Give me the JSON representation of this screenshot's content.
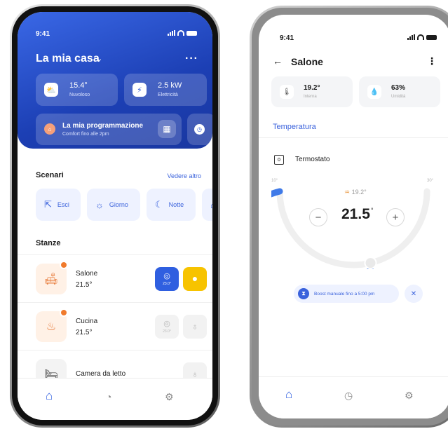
{
  "phone1": {
    "time": "9:41",
    "home_title": "La mia casa",
    "caret": "⌄",
    "more": "···",
    "tiles": [
      {
        "icon": "weather-icon",
        "glyph": "⛅",
        "value": "15.4°",
        "label": "Nuvoloso"
      },
      {
        "icon": "lightning-icon",
        "glyph": "⚡",
        "value": "2.5 kW",
        "label": "Elettricità"
      }
    ],
    "schedule": {
      "title": "La mia programmazione",
      "subtitle": "Comfort fino alle 2pm"
    },
    "scenes_title": "Scenari",
    "scenes_more": "Vedere altro",
    "scenes": [
      {
        "icon": "exit-icon",
        "glyph": "⇱",
        "label": "Esci"
      },
      {
        "icon": "sun-icon",
        "glyph": "☼",
        "label": "Giorno"
      },
      {
        "icon": "moon-icon",
        "glyph": "☾",
        "label": "Notte"
      }
    ],
    "rooms_title": "Stanze",
    "rooms": [
      {
        "name": "Salone",
        "temp": "21.5°",
        "thermostat": "23.0°",
        "glyph": "🛋"
      },
      {
        "name": "Cucina",
        "temp": "21.5°",
        "thermostat": "23.0°",
        "glyph": "♨"
      },
      {
        "name": "Camera da letto",
        "temp": "",
        "glyph": "🛏"
      }
    ],
    "tabs": {
      "home": "⌂",
      "history": "◔",
      "settings": "⚙"
    }
  },
  "phone2": {
    "time": "9:41",
    "back": "←",
    "title": "Salone",
    "more": "⋮",
    "indoor": {
      "value": "19.2°",
      "label": "Interna"
    },
    "humidity": {
      "value": "63%",
      "label": "Umidità"
    },
    "section_tab": "Temperatura",
    "thermostat_label": "Termostato",
    "range_min": "10°",
    "range_max": "30°",
    "current": "19.2°",
    "setpoint": "21.5",
    "setpoint_unit": "°",
    "minus": "−",
    "plus": "+",
    "boost": "Boost manuale fino a 5:00 pm",
    "boost_close": "✕",
    "setpoint_fraction": 0.575,
    "tabs": {
      "home": "⌂",
      "history": "◷",
      "settings": "⚙"
    }
  },
  "colors": {
    "accent": "#3a62dc",
    "hero": "#1c3fb4",
    "heat": "#f07a2c",
    "light": "#f7c300"
  }
}
